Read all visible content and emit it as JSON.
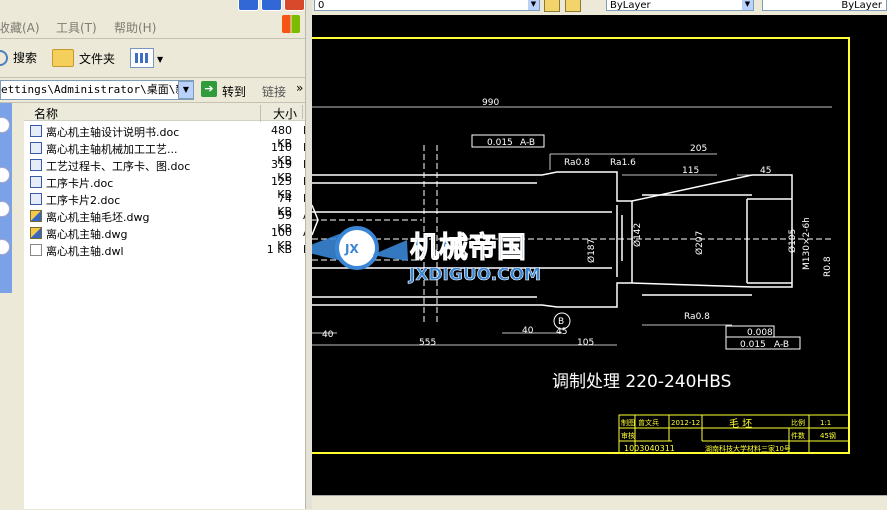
{
  "explorer": {
    "menu": {
      "favorites": "收藏(A)",
      "tools": "工具(T)",
      "help": "帮助(H)"
    },
    "toolbar": {
      "search": "搜索",
      "folders": "文件夹"
    },
    "address": {
      "path": "ettings\\Administrator\\桌面\\新建",
      "go": "转到",
      "links": "链接"
    },
    "columns": {
      "name": "名称",
      "size": "大小"
    },
    "files": [
      {
        "name": "离心机主轴设计说明书.doc",
        "size": "480 KB",
        "type": "M",
        "icon": "doc-icon"
      },
      {
        "name": "离心机主轴机械加工工艺...",
        "size": "110 KB",
        "type": "M",
        "icon": "doc-icon"
      },
      {
        "name": "工艺过程卡、工序卡、图.doc",
        "size": "319 KB",
        "type": "M",
        "icon": "doc-icon"
      },
      {
        "name": "工序卡片.doc",
        "size": "125 KB",
        "type": "M",
        "icon": "doc-icon"
      },
      {
        "name": "工序卡片2.doc",
        "size": "74 KB",
        "type": "M",
        "icon": "doc-icon"
      },
      {
        "name": "离心机主轴毛坯.dwg",
        "size": "59 KB",
        "type": "A",
        "icon": "dwg-icon"
      },
      {
        "name": "离心机主轴.dwg",
        "size": "100 KB",
        "type": "A",
        "icon": "dwg-icon"
      },
      {
        "name": "离心机主轴.dwl",
        "size": "1 KB",
        "type": "F",
        "icon": "dwl-icon"
      }
    ]
  },
  "cad": {
    "layer": "0",
    "color": "ByLayer",
    "linetype": "ByLayer",
    "dims": {
      "total_length": "990",
      "tol1": "0.015",
      "datum": "A-B",
      "rough1": "Ra0.8",
      "rough2": "Ra1.6",
      "d205": "205",
      "d115": "115",
      "d45": "45",
      "dia_left": "Ø187",
      "dia_142": "Ø142",
      "dia_207": "Ø207",
      "dia_105": "Ø105",
      "thread": "M130×2-6h",
      "r08": "R0.8",
      "ra08b": "Ra0.8",
      "d40a": "40",
      "d40b": "40",
      "d45b": "45",
      "d555": "555",
      "d105": "105",
      "datum_b": "B",
      "flat": "0.008",
      "tol2": "0.015",
      "datum2": "A-B",
      "treatment": "调制处理  220-240HBS"
    },
    "titleblock": {
      "r1c1": "制图",
      "r1c2": "曾文兵",
      "r1c3": "2012-12",
      "title": "毛  坯",
      "scale_label": "比例",
      "scale": "1:1",
      "r2c1": "审核",
      "qty_label": "件数",
      "qty": "45钢",
      "drawing_no": "1003040311",
      "school": "湖南科技大学材料三家10号"
    },
    "watermark": {
      "cn": "机械帝国",
      "en": "JXDIGUO.COM",
      "badge": "JX"
    }
  },
  "colors": {
    "cad_line": "#ffffff",
    "cad_frame": "#ffff33",
    "watermark": "#3a86d4"
  }
}
